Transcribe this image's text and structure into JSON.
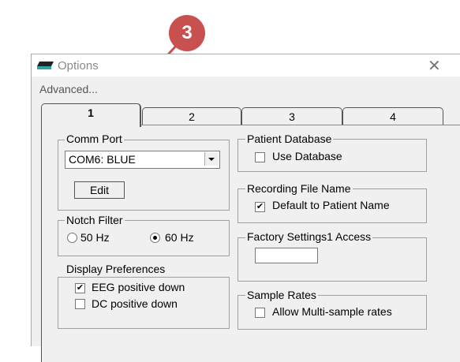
{
  "callout": {
    "number": "3",
    "color": "#c8504f"
  },
  "window": {
    "title": "Options",
    "menu": "Advanced...",
    "close_glyph": "✕"
  },
  "tabs": [
    {
      "label": "1",
      "active": true
    },
    {
      "label": "2"
    },
    {
      "label": "3"
    },
    {
      "label": "4"
    }
  ],
  "comm_port": {
    "group_label": "Comm Port",
    "selected": "COM6: BLUE",
    "edit_label": "Edit"
  },
  "notch_filter": {
    "group_label": "Notch Filter",
    "option_50": "50 Hz",
    "option_60": "60 Hz",
    "selected": "60 Hz"
  },
  "display_preferences": {
    "group_label": "Display Preferences",
    "eeg_label": "EEG positive down",
    "eeg_checked": true,
    "dc_label": "DC positive down",
    "dc_checked": false
  },
  "patient_database": {
    "group_label": "Patient Database",
    "use_label": "Use Database",
    "use_checked": false
  },
  "recording_file_name": {
    "group_label": "Recording File Name",
    "default_label": "Default to Patient Name",
    "default_checked": true
  },
  "factory_settings": {
    "group_label": "Factory Settings1 Access",
    "value": ""
  },
  "sample_rates": {
    "group_label": "Sample Rates",
    "multi_label": "Allow Multi-sample rates",
    "multi_checked": false
  }
}
